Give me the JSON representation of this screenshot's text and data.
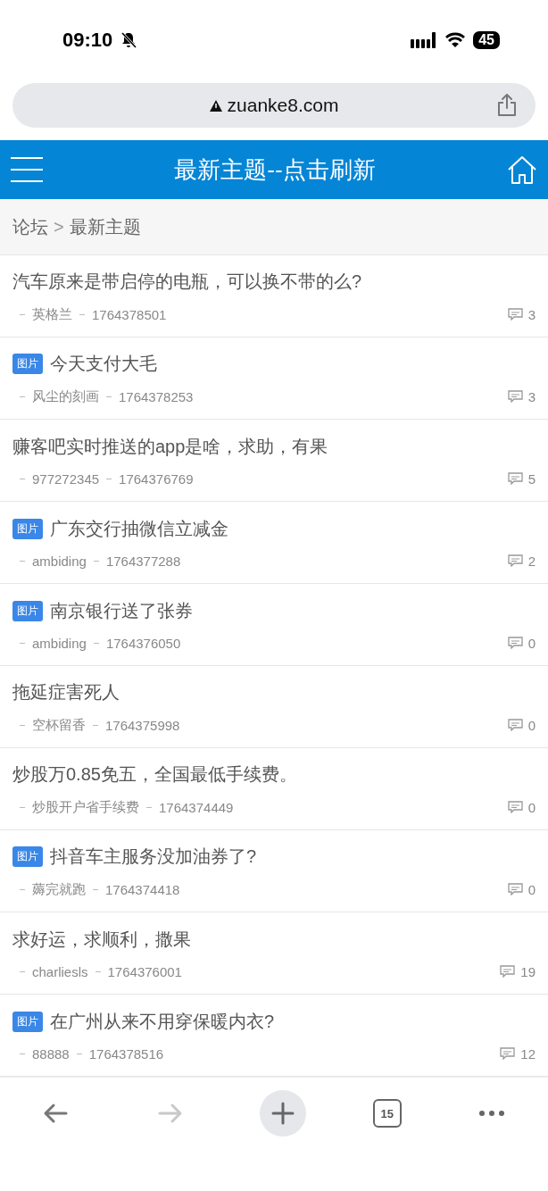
{
  "status_bar": {
    "time": "09:10",
    "battery": "45"
  },
  "address_bar": {
    "url": "zuanke8.com"
  },
  "header": {
    "title": "最新主题--点击刷新"
  },
  "breadcrumb": {
    "items": [
      "论坛",
      "最新主题"
    ],
    "separator": ">"
  },
  "threads": [
    {
      "has_image": false,
      "title": "汽车原来是带启停的电瓶，可以换不带的么?",
      "author": "英格兰",
      "time": "1764378501",
      "replies": "3"
    },
    {
      "has_image": true,
      "badge": "图片",
      "title": "今天支付大毛",
      "author": "风尘的刻画",
      "time": "1764378253",
      "replies": "3"
    },
    {
      "has_image": false,
      "title": "赚客吧实时推送的app是啥，求助，有果",
      "author": "977272345",
      "time": "1764376769",
      "replies": "5"
    },
    {
      "has_image": true,
      "badge": "图片",
      "title": "广东交行抽微信立减金",
      "author": "ambiding",
      "time": "1764377288",
      "replies": "2"
    },
    {
      "has_image": true,
      "badge": "图片",
      "title": "南京银行送了张券",
      "author": "ambiding",
      "time": "1764376050",
      "replies": "0"
    },
    {
      "has_image": false,
      "title": "拖延症害死人",
      "author": "空杯留香",
      "time": "1764375998",
      "replies": "0"
    },
    {
      "has_image": false,
      "title": "炒股万0.85免五，全国最低手续费。",
      "author": "炒股开户省手续费",
      "time": "1764374449",
      "replies": "0"
    },
    {
      "has_image": true,
      "badge": "图片",
      "title": "抖音车主服务没加油券了?",
      "author": "薅完就跑",
      "time": "1764374418",
      "replies": "0"
    },
    {
      "has_image": false,
      "title": "求好运，求顺利，撒果",
      "author": "charliesls",
      "time": "1764376001",
      "replies": "19"
    },
    {
      "has_image": true,
      "badge": "图片",
      "title": "在广州从来不用穿保暖内衣?",
      "author": "88888",
      "time": "1764378516",
      "replies": "12"
    }
  ],
  "toolbar": {
    "back_disabled": false,
    "forward_disabled": true,
    "tab_count": "15"
  }
}
